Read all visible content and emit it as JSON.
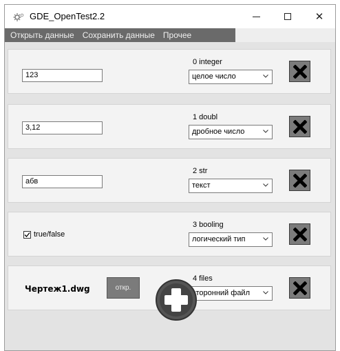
{
  "window": {
    "title": "GDE_OpenTest2.2",
    "minimize_icon": "minimize-icon",
    "maximize_icon": "maximize-icon",
    "close_glyph": "✕"
  },
  "menu": {
    "items": [
      {
        "label": "Открыть данные"
      },
      {
        "label": "Сохранить данные"
      },
      {
        "label": "Прочее"
      }
    ]
  },
  "rows": [
    {
      "value": "123",
      "type_label": "0 integer",
      "type_value": "целое число"
    },
    {
      "value": "3,12",
      "type_label": "1 doubl",
      "type_value": "дробное число"
    },
    {
      "value": "абв",
      "type_label": "2 str",
      "type_value": "текст"
    },
    {
      "checkbox_label": "true/false",
      "checked": true,
      "type_label": "3 booling",
      "type_value": "логический тип"
    },
    {
      "file_name": "Чертеж1.dwg",
      "open_label": "откр.",
      "type_label": "4 files",
      "type_value": "сторонний файл"
    }
  ],
  "colors": {
    "menubar": "#6a6a6a",
    "button_gray": "#7b7b7b",
    "panel_bg": "#f3f3f3",
    "content_bg": "#e3e3e3"
  }
}
